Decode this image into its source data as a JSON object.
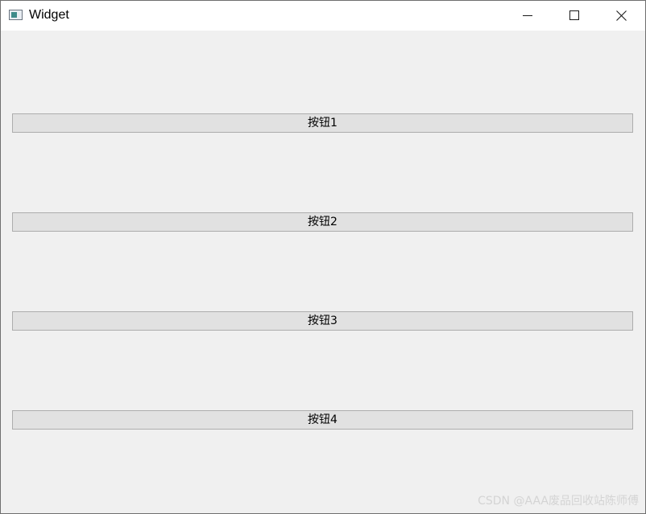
{
  "window": {
    "title": "Widget",
    "controls": {
      "minimize_icon": "minimize-icon",
      "maximize_icon": "maximize-icon",
      "close_icon": "close-icon"
    }
  },
  "buttons": [
    {
      "label": "按钮1"
    },
    {
      "label": "按钮2"
    },
    {
      "label": "按钮3"
    },
    {
      "label": "按钮4"
    }
  ],
  "watermark": "CSDN @AAA废品回收站陈师傅",
  "colors": {
    "background": "#f0f0f0",
    "button_face": "#e1e1e1",
    "button_border": "#adadad",
    "titlebar": "#ffffff"
  }
}
